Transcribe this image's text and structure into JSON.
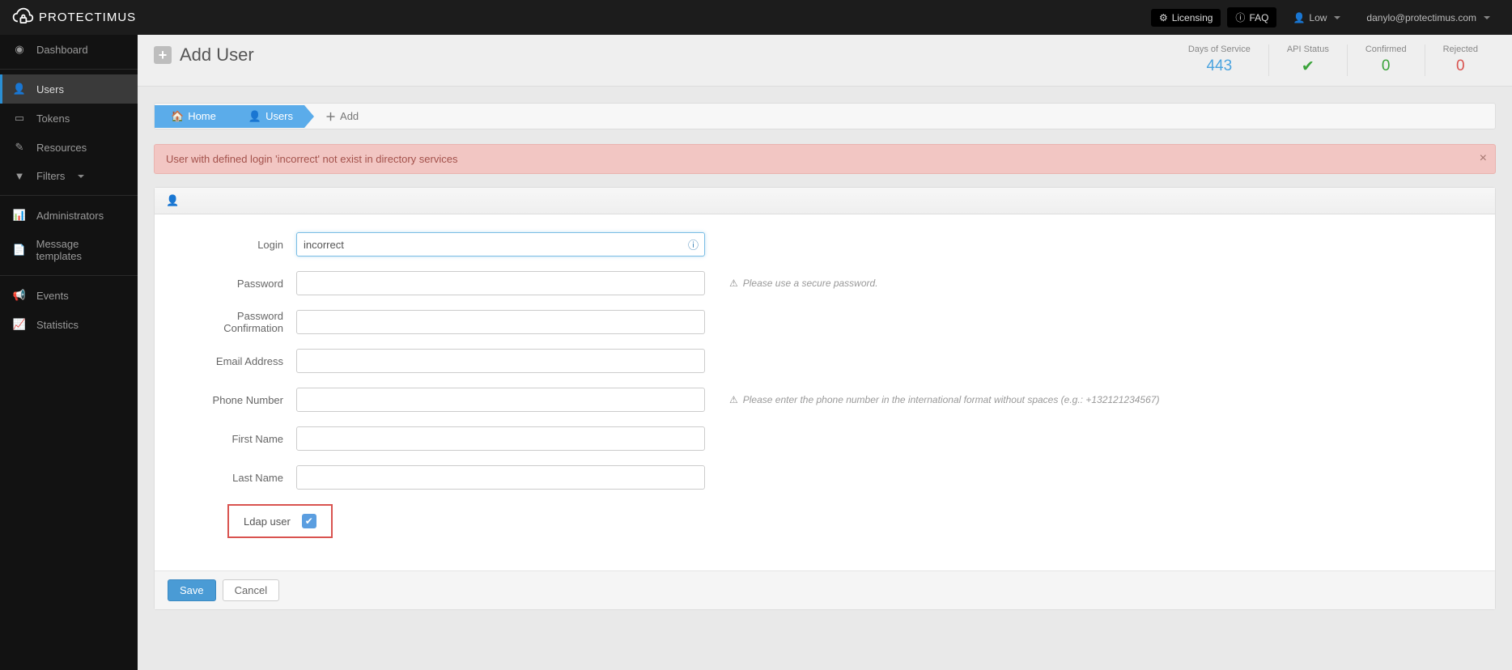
{
  "brand": "PROTECTIMUS",
  "topbar": {
    "licensing": "Licensing",
    "faq": "FAQ",
    "security_label": "Low",
    "user_email": "danylo@protectimus.com"
  },
  "sidebar": {
    "dashboard": "Dashboard",
    "users": "Users",
    "tokens": "Tokens",
    "resources": "Resources",
    "filters": "Filters",
    "administrators": "Administrators",
    "message_templates": "Message templates",
    "events": "Events",
    "statistics": "Statistics"
  },
  "page": {
    "title": "Add User"
  },
  "stats": {
    "days_label": "Days of Service",
    "days_value": "443",
    "api_label": "API Status",
    "confirmed_label": "Confirmed",
    "confirmed_value": "0",
    "rejected_label": "Rejected",
    "rejected_value": "0"
  },
  "breadcrumbs": {
    "home": "Home",
    "users": "Users",
    "add": "Add"
  },
  "alert": {
    "text": "User with defined login 'incorrect' not exist in directory services"
  },
  "form": {
    "login_label": "Login",
    "login_value": "incorrect",
    "password_label": "Password",
    "password_hint": "Please use a secure password.",
    "password_confirm_label": "Password Confirmation",
    "email_label": "Email Address",
    "phone_label": "Phone Number",
    "phone_hint": "Please enter the phone number in the international format without spaces (e.g.: +132121234567)",
    "first_name_label": "First Name",
    "last_name_label": "Last Name",
    "ldap_label": "Ldap user"
  },
  "buttons": {
    "save": "Save",
    "cancel": "Cancel"
  }
}
